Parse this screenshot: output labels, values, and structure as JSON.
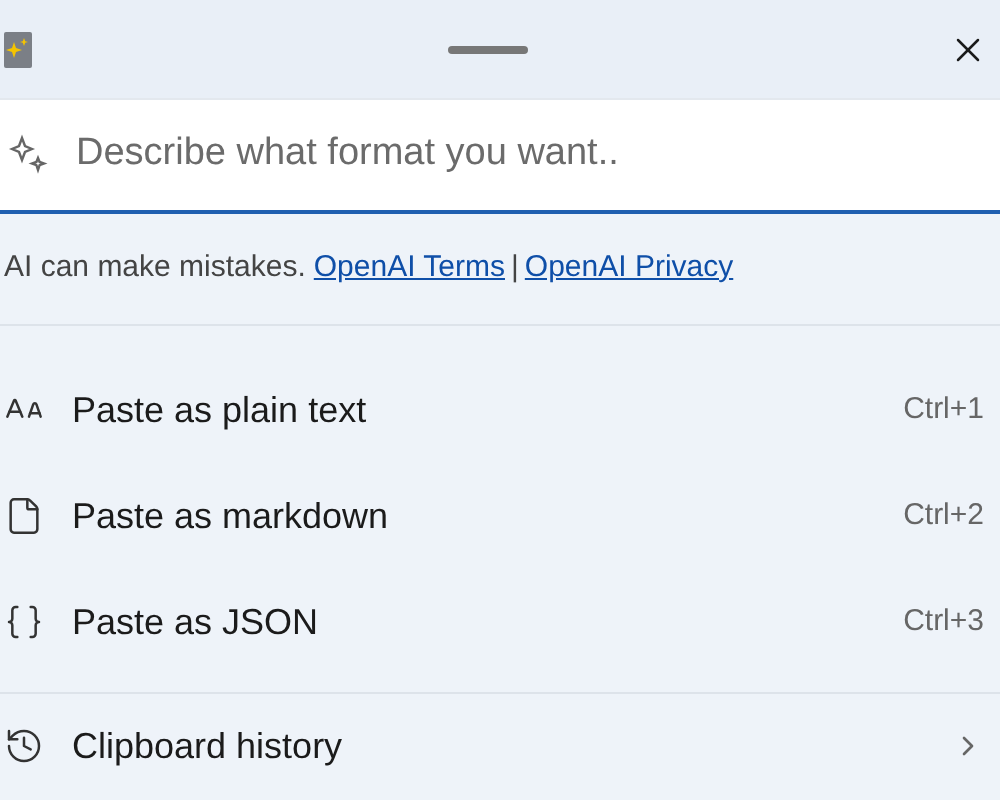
{
  "search": {
    "placeholder": "Describe what format you want.."
  },
  "disclaimer": {
    "text": "AI can make mistakes.",
    "links": [
      "OpenAI Terms",
      "OpenAI Privacy"
    ],
    "separator": "|"
  },
  "actions": [
    {
      "kind": "text",
      "label": "Paste as plain text",
      "shortcut": "Ctrl+1"
    },
    {
      "kind": "markdown",
      "label": "Paste as markdown",
      "shortcut": "Ctrl+2"
    },
    {
      "kind": "json",
      "label": "Paste as JSON",
      "shortcut": "Ctrl+3"
    }
  ],
  "history": {
    "label": "Clipboard history"
  }
}
